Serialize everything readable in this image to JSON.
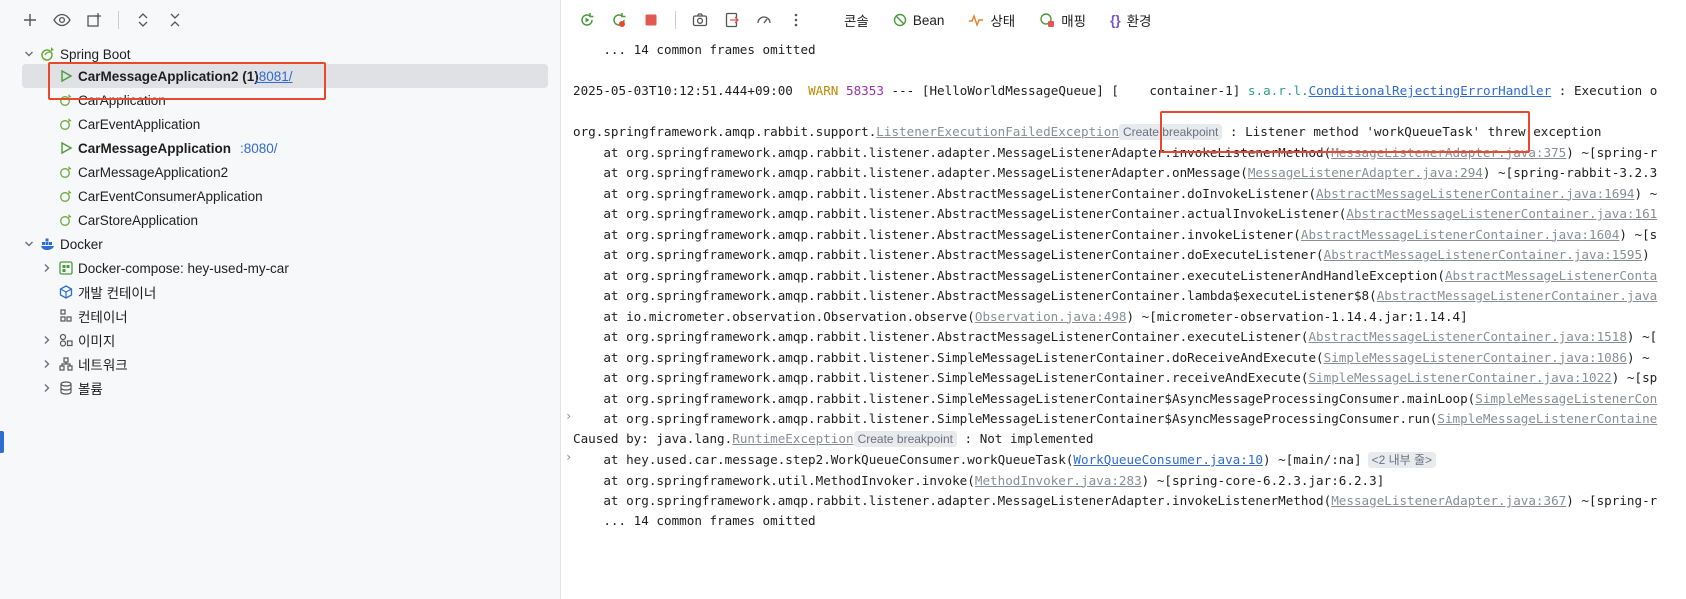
{
  "left_toolbar": {
    "icons": [
      "add-icon",
      "eye-icon",
      "new-window-icon",
      "expand-icon",
      "collapse-icon"
    ]
  },
  "tree": {
    "spring_boot": {
      "label": "Spring Boot"
    },
    "apps": [
      {
        "label": "CarMessageApplication2 (1)",
        "port": ":8081/",
        "running": true,
        "bold": true
      },
      {
        "label": "CarApplication",
        "port": "",
        "running": false,
        "bold": false
      },
      {
        "label": "CarEventApplication",
        "port": "",
        "running": false,
        "bold": false
      },
      {
        "label": "CarMessageApplication",
        "port": ":8080/",
        "running": true,
        "bold": true
      },
      {
        "label": "CarMessageApplication2",
        "port": "",
        "running": false,
        "bold": false
      },
      {
        "label": "CarEventConsumerApplication",
        "port": "",
        "running": false,
        "bold": false
      },
      {
        "label": "CarStoreApplication",
        "port": "",
        "running": false,
        "bold": false
      }
    ],
    "docker": {
      "label": "Docker"
    },
    "docker_items": [
      {
        "label": "Docker-compose: hey-used-my-car"
      },
      {
        "label": "개발 컨테이너"
      },
      {
        "label": "컨테이너"
      },
      {
        "label": "이미지"
      },
      {
        "label": "네트워크"
      },
      {
        "label": "볼륨"
      }
    ]
  },
  "right_toolbar": {
    "tabs": [
      {
        "label": "콘솔"
      },
      {
        "label": "Bean"
      },
      {
        "label": "상태"
      },
      {
        "label": "매핑"
      },
      {
        "label": "환경"
      }
    ]
  },
  "console": {
    "line_omitted_top": "    ... 14 common frames omitted",
    "log_line": {
      "timestamp": "2025-05-03T10:12:51.444+09:00",
      "level": "WARN",
      "pid": "58353",
      "dashes": "---",
      "thread": "[HelloWorldMessageQueue] [    container-1]",
      "logger_prefix": "s.a.r.l.",
      "logger_link": "ConditionalRejectingErrorHandler",
      "message": " : Execution o"
    },
    "exception": {
      "package": "org.springframework.amqp.rabbit.support.",
      "class_link": "ListenerExecutionFailedException",
      "breakpoint": "Create breakpoint",
      "message": ": Listener method 'workQueueTask' threw exception"
    },
    "frames": [
      {
        "text": "    at org.springframework.amqp.rabbit.listener.adapter.MessageListenerAdapter.invokeListenerMethod(",
        "link": "MessageListenerAdapter.java:375",
        "tail": ") ~[spring-r"
      },
      {
        "text": "    at org.springframework.amqp.rabbit.listener.adapter.MessageListenerAdapter.onMessage(",
        "link": "MessageListenerAdapter.java:294",
        "tail": ") ~[spring-rabbit-3.2.3"
      },
      {
        "text": "    at org.springframework.amqp.rabbit.listener.AbstractMessageListenerContainer.doInvokeListener(",
        "link": "AbstractMessageListenerContainer.java:1694",
        "tail": ") ~"
      },
      {
        "text": "    at org.springframework.amqp.rabbit.listener.AbstractMessageListenerContainer.actualInvokeListener(",
        "link": "AbstractMessageListenerContainer.java:161",
        "tail": ""
      },
      {
        "text": "    at org.springframework.amqp.rabbit.listener.AbstractMessageListenerContainer.invokeListener(",
        "link": "AbstractMessageListenerContainer.java:1604",
        "tail": ") ~[s"
      },
      {
        "text": "    at org.springframework.amqp.rabbit.listener.AbstractMessageListenerContainer.doExecuteListener(",
        "link": "AbstractMessageListenerContainer.java:1595",
        "tail": ")"
      },
      {
        "text": "    at org.springframework.amqp.rabbit.listener.AbstractMessageListenerContainer.executeListenerAndHandleException(",
        "link": "AbstractMessageListenerConta",
        "tail": ""
      },
      {
        "text": "    at org.springframework.amqp.rabbit.listener.AbstractMessageListenerContainer.lambda$executeListener$8(",
        "link": "AbstractMessageListenerContainer.java",
        "tail": ""
      },
      {
        "text": "    at io.micrometer.observation.Observation.observe(",
        "link": "Observation.java:498",
        "tail": ") ~[micrometer-observation-1.14.4.jar:1.14.4]"
      },
      {
        "text": "    at org.springframework.amqp.rabbit.listener.AbstractMessageListenerContainer.executeListener(",
        "link": "AbstractMessageListenerContainer.java:1518",
        "tail": ") ~["
      },
      {
        "text": "    at org.springframework.amqp.rabbit.listener.SimpleMessageListenerContainer.doReceiveAndExecute(",
        "link": "SimpleMessageListenerContainer.java:1086",
        "tail": ") ~"
      },
      {
        "text": "    at org.springframework.amqp.rabbit.listener.SimpleMessageListenerContainer.receiveAndExecute(",
        "link": "SimpleMessageListenerContainer.java:1022",
        "tail": ") ~[sp"
      },
      {
        "text": "    at org.springframework.amqp.rabbit.listener.SimpleMessageListenerContainer$AsyncMessageProcessingConsumer.mainLoop(",
        "link": "SimpleMessageListenerCon",
        "tail": ""
      },
      {
        "text": "    at org.springframework.amqp.rabbit.listener.SimpleMessageListenerContainer$AsyncMessageProcessingConsumer.run(",
        "link": "SimpleMessageListenerContaine",
        "tail": ""
      }
    ],
    "caused_by": {
      "prefix": "Caused by: java.lang.",
      "class_link": "RuntimeException",
      "breakpoint": "Create breakpoint",
      "message": ": Not implemented"
    },
    "cause_frames": [
      {
        "text": "    at hey.used.car.message.step2.WorkQueueConsumer.workQueueTask(",
        "link": "WorkQueueConsumer.java:10",
        "tail": ") ~[main/:na]",
        "badge": "<2 내부 줄>",
        "user_code": true
      },
      {
        "text": "    at org.springframework.util.MethodInvoker.invoke(",
        "link": "MethodInvoker.java:283",
        "tail": ") ~[spring-core-6.2.3.jar:6.2.3]",
        "badge": "",
        "user_code": false
      },
      {
        "text": "    at org.springframework.amqp.rabbit.listener.adapter.MessageListenerAdapter.invokeListenerMethod(",
        "link": "MessageListenerAdapter.java:367",
        "tail": ") ~[spring-r",
        "badge": "",
        "user_code": false
      }
    ],
    "line_omitted_bottom": "    ... 14 common frames omitted"
  }
}
